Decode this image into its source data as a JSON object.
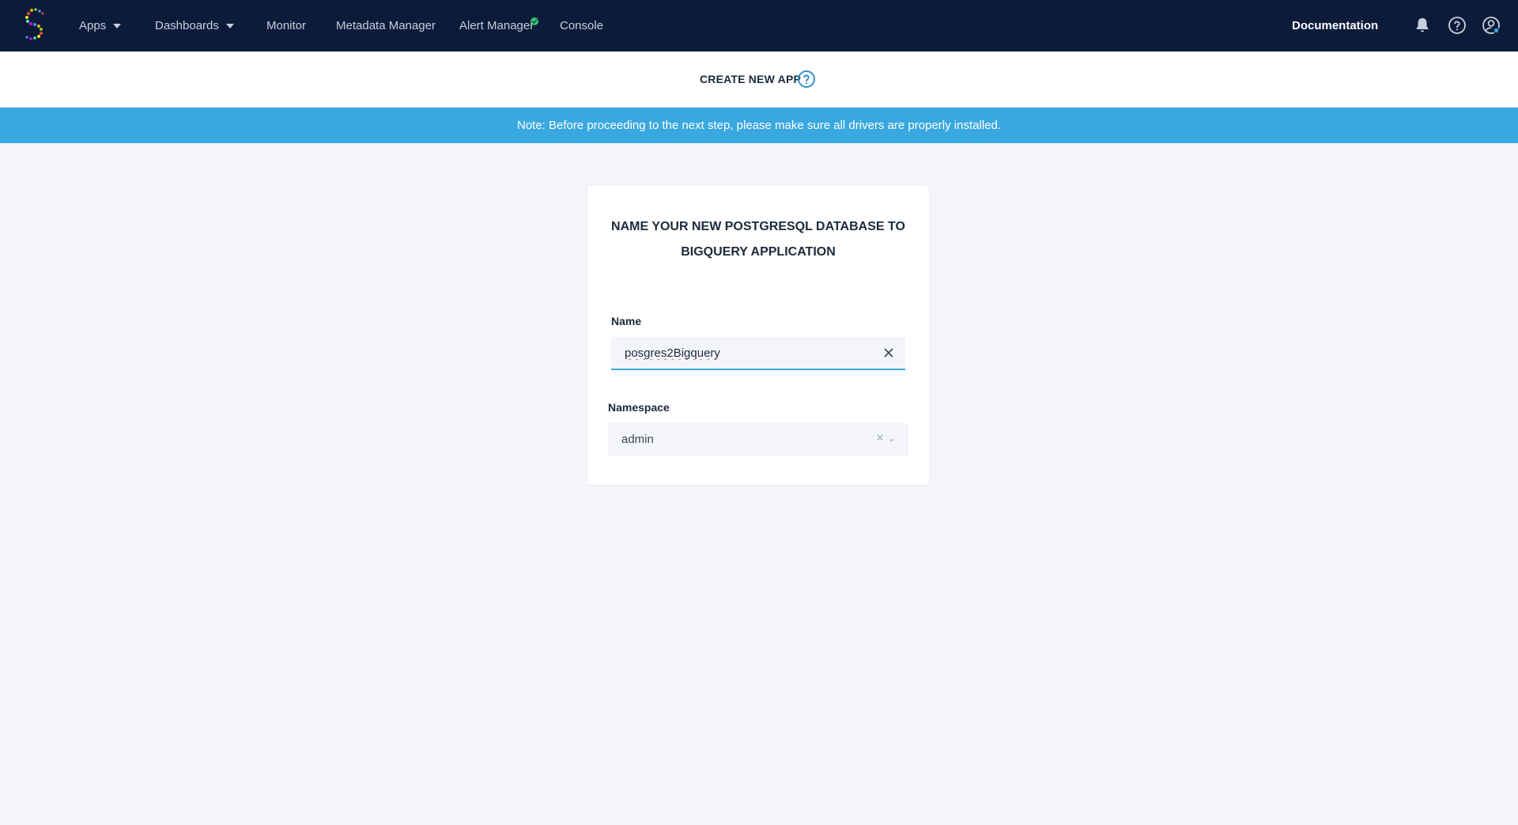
{
  "nav": {
    "apps": "Apps",
    "dashboards": "Dashboards",
    "monitor": "Monitor",
    "metadata_manager": "Metadata Manager",
    "alert_manager": "Alert Manager",
    "console": "Console",
    "documentation": "Documentation"
  },
  "header": {
    "title": "CREATE NEW APP"
  },
  "banner": {
    "text": "Note: Before proceeding to the next step, please make sure all drivers are properly installed."
  },
  "form": {
    "title_line1": "NAME YOUR NEW POSTGRESQL DATABASE TO",
    "title_line2": "BIGQUERY APPLICATION",
    "name_label": "Name",
    "name_value": "posgres2Bigquery",
    "namespace_label": "Namespace",
    "namespace_value": "admin"
  },
  "colors": {
    "nav_bg": "#0d1b3a",
    "banner_bg": "#3aa8e0",
    "accent": "#3aa8e0",
    "page_bg": "#f4f5fb",
    "status_green": "#35c16e"
  },
  "icons": {
    "logo": "striim-logo",
    "bell": "bell-icon",
    "help": "help-icon",
    "user": "user-settings-icon",
    "clear": "close-icon",
    "chevron": "chevron-down-icon"
  }
}
